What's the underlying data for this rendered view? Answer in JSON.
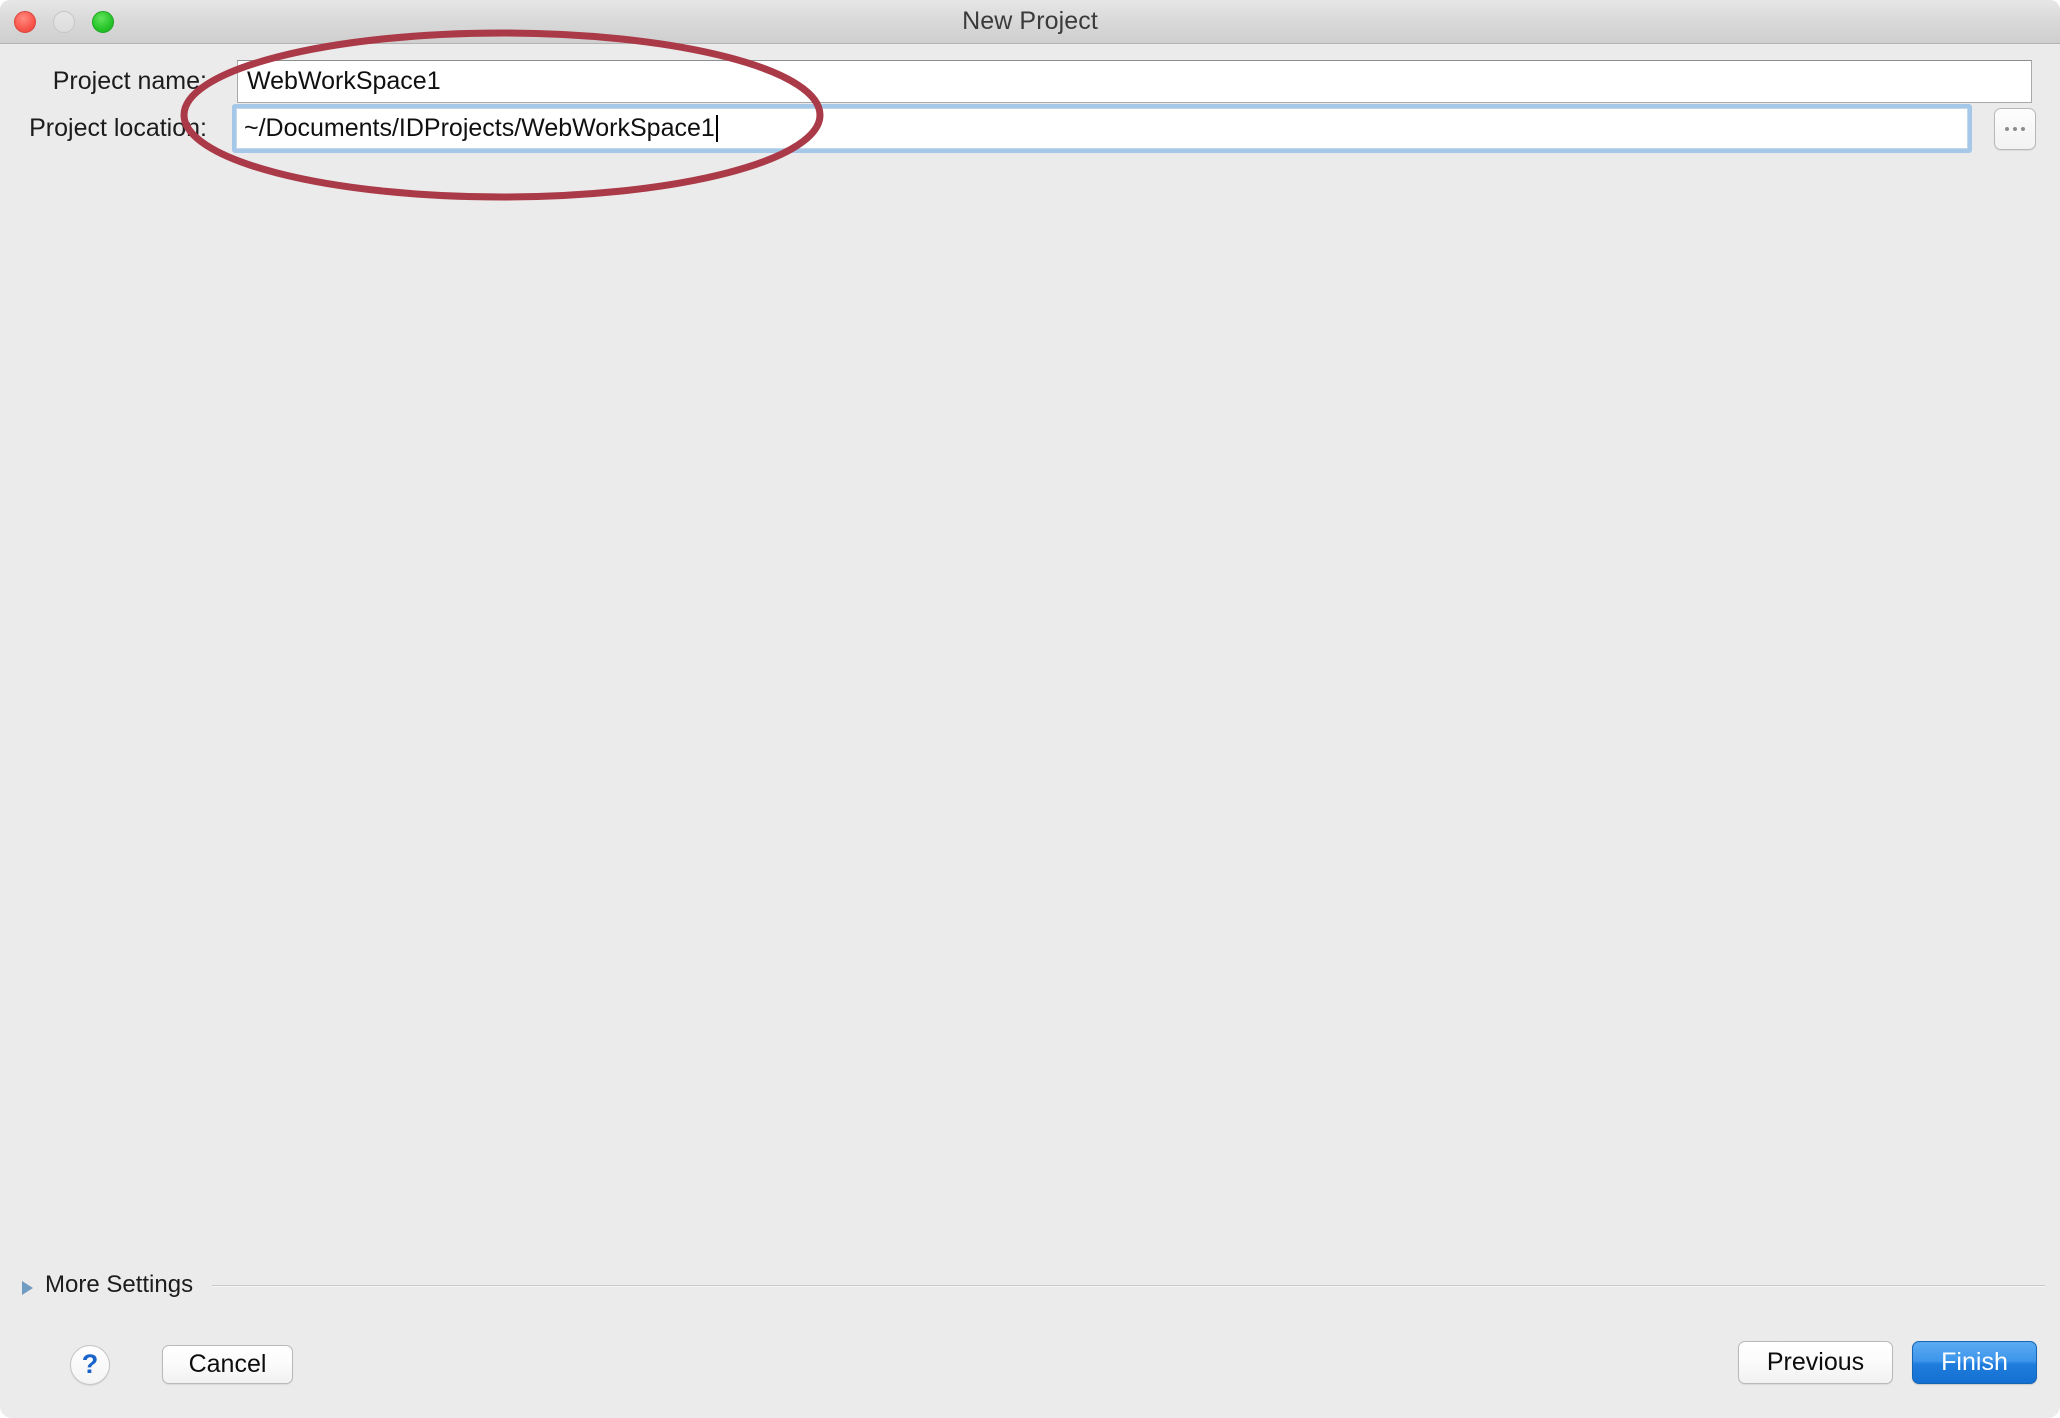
{
  "window": {
    "title": "New Project",
    "controls": {
      "close": "close-button",
      "minimize": "minimize-button",
      "maximize": "maximize-button"
    },
    "background_color": "#ebebeb"
  },
  "form": {
    "project_name": {
      "label": "Project name:",
      "value": "WebWorkSpace1",
      "placeholder": ""
    },
    "project_location": {
      "label": "Project location:",
      "value": "~/Documents/IDProjects/WebWorkSpace1",
      "placeholder": "",
      "focused": true,
      "browse_label": "..."
    }
  },
  "more_settings": {
    "label": "More Settings",
    "expanded": false,
    "triangle_icon": "disclosure-triangle-right-icon"
  },
  "footer": {
    "help_label": "?",
    "cancel_label": "Cancel",
    "previous_label": "Previous",
    "finish_label": "Finish"
  },
  "annotation": {
    "shape": "ellipse",
    "color": "#ab3a48",
    "stroke_width": 7
  }
}
